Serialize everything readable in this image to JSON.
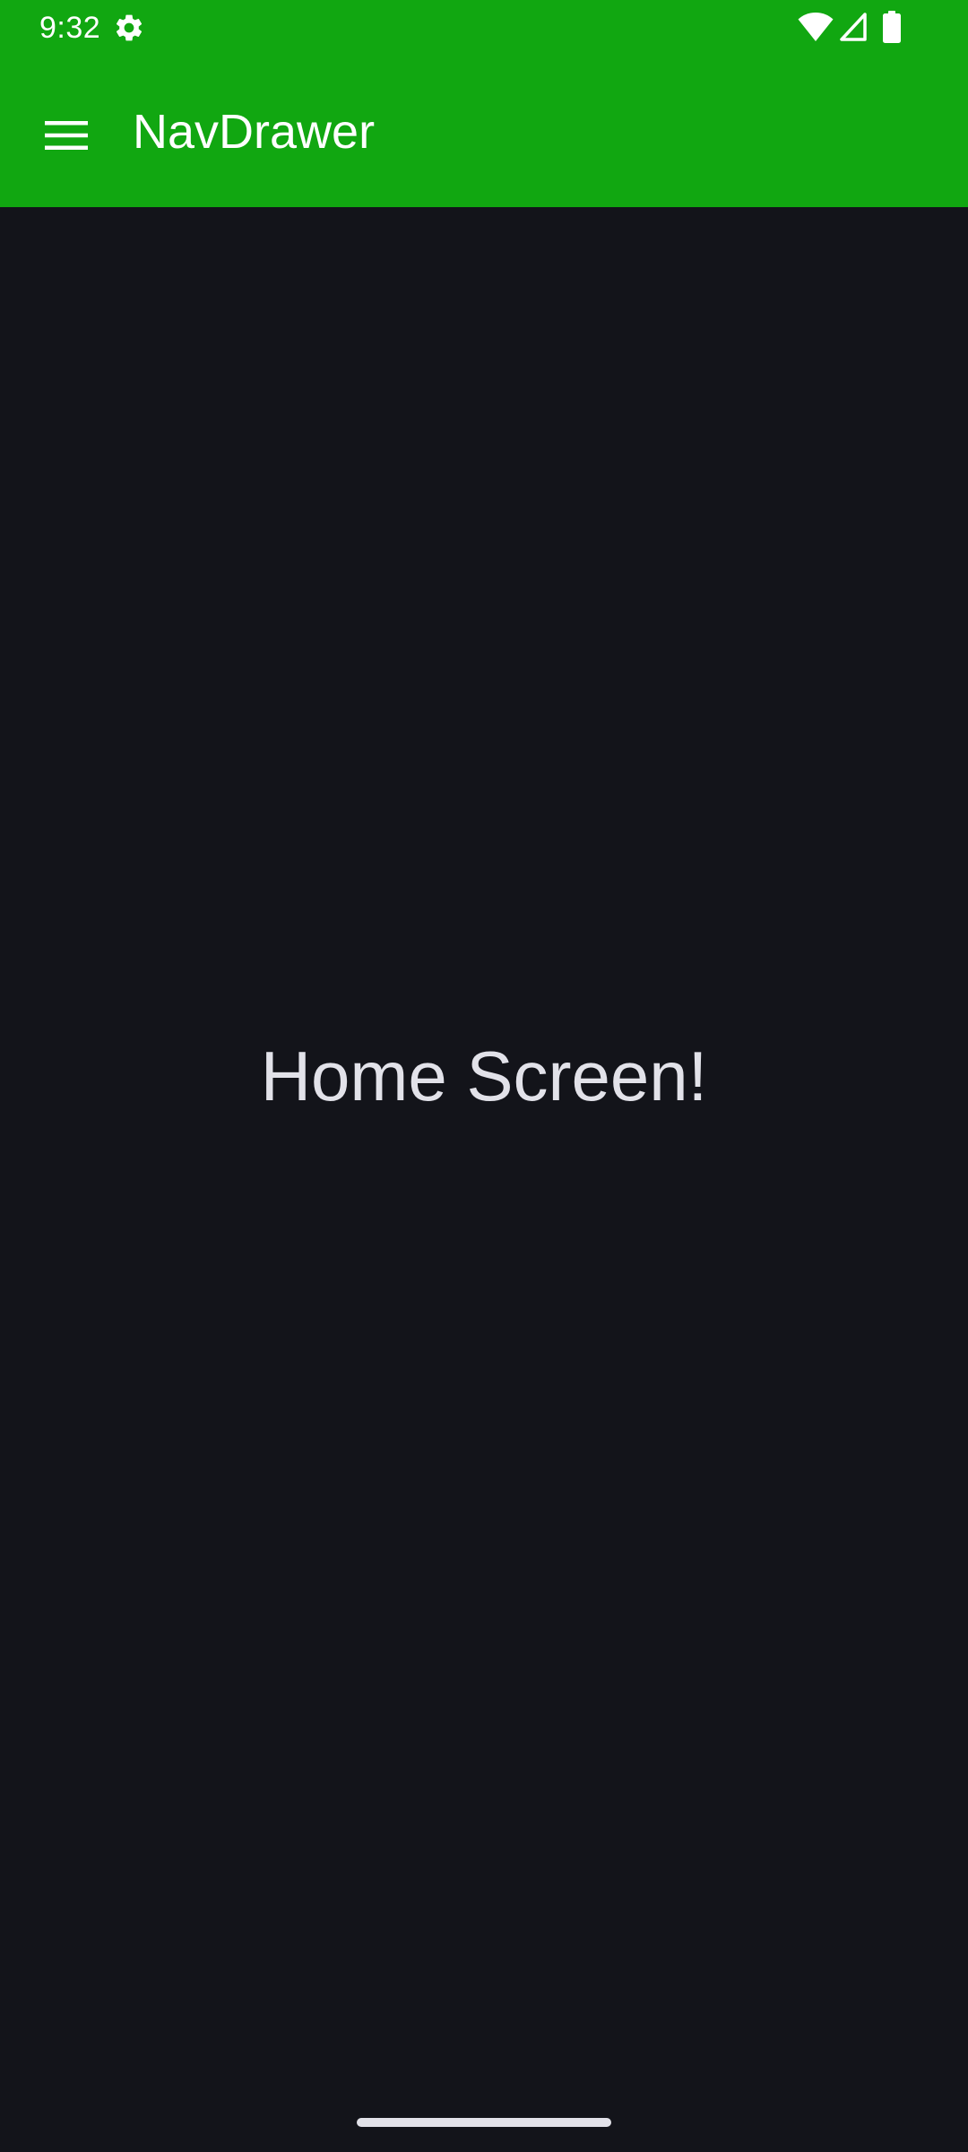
{
  "status_bar": {
    "time": "9:32",
    "icons": [
      "gear-icon",
      "wifi-icon",
      "signal-icon",
      "battery-icon"
    ]
  },
  "app_bar": {
    "title": "NavDrawer",
    "menu_icon": "hamburger-menu-icon"
  },
  "main": {
    "text": "Home Screen!"
  },
  "colors": {
    "app_bar_background": "#11A711",
    "screen_background": "#13141A",
    "on_primary_text": "#FFFFFF",
    "content_text": "#E2E2E9"
  }
}
